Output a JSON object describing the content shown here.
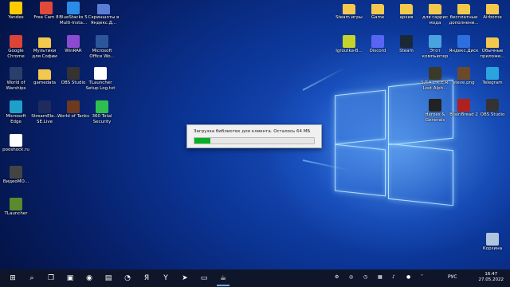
{
  "desktop": {
    "icons": [
      {
        "id": "yandex",
        "label": "Yandex",
        "icon": "yandex-icon",
        "color": "#ffcc00"
      },
      {
        "id": "freecam",
        "label": "Free Cam 8",
        "icon": "camera-icon",
        "color": "#e14a3b"
      },
      {
        "id": "bluestacks",
        "label": "BlueStacks 5 Multi-Insta...",
        "icon": "bluestacks-icon",
        "color": "#2b8be6"
      },
      {
        "id": "screenshots",
        "label": "Скриншоты в Яндекс.Д...",
        "icon": "folder-icon",
        "color": "#5a7dd6"
      },
      {
        "id": "chrome",
        "label": "Google Chrome",
        "icon": "chrome-icon",
        "color": "#db4437"
      },
      {
        "id": "cartoons",
        "label": "Мультики для Софии",
        "icon": "folder-icon",
        "color": "#f2c94c"
      },
      {
        "id": "winrar",
        "label": "WinRAR",
        "icon": "winrar-icon",
        "color": "#8a4bd1"
      },
      {
        "id": "msoffice",
        "label": "Microsoft Office Wo...",
        "icon": "word-icon",
        "color": "#2b579a"
      },
      {
        "id": "wows",
        "label": "World of Warships",
        "icon": "warships-icon",
        "color": "#2a3f6b"
      },
      {
        "id": "gamedata",
        "label": "gamedata",
        "icon": "folder-icon",
        "color": "#f2c94c"
      },
      {
        "id": "obs",
        "label": "OBS Studio",
        "icon": "obs-icon",
        "color": "#333333"
      },
      {
        "id": "tlauncherlog",
        "label": "TLauncher Setup Log.txt",
        "icon": "text-file-icon",
        "color": "#ffffff"
      },
      {
        "id": "edge",
        "label": "Microsoft Edge",
        "icon": "edge-icon",
        "color": "#1fa0c9"
      },
      {
        "id": "streamelements",
        "label": "StreamEle... SE.Live",
        "icon": "streamelements-icon",
        "color": "#1e2b5c"
      },
      {
        "id": "wot",
        "label": "World of Tanks",
        "icon": "tanks-icon",
        "color": "#6b3a1f"
      },
      {
        "id": "360",
        "label": "360 Total Security",
        "icon": "security-icon",
        "color": "#2fbf4f"
      },
      {
        "id": "pooshock",
        "label": "pooshock.ru",
        "icon": "document-icon",
        "color": "#ffffff"
      },
      {
        "id": "video",
        "label": "ВидеоМО...",
        "icon": "video-icon",
        "color": "#444444"
      },
      {
        "id": "tlauncher",
        "label": "TLauncher",
        "icon": "minecraft-icon",
        "color": "#5a8a2e"
      },
      {
        "id": "steamgames",
        "label": "Steam игры",
        "icon": "folder-icon",
        "color": "#f2c94c"
      },
      {
        "id": "game",
        "label": "Game",
        "icon": "folder-icon",
        "color": "#f2c94c"
      },
      {
        "id": "archive",
        "label": "архив",
        "icon": "folder-icon",
        "color": "#f2c94c"
      },
      {
        "id": "gorris",
        "label": "для гаррис мода",
        "icon": "folder-icon",
        "color": "#f2c94c"
      },
      {
        "id": "freeaddons",
        "label": "бесплатные дополнени...",
        "icon": "folder-icon",
        "color": "#f2c94c"
      },
      {
        "id": "airborne",
        "label": "Airborne",
        "icon": "folder-icon",
        "color": "#f2c94c"
      },
      {
        "id": "igroutka",
        "label": "Igroutka-B...",
        "icon": "game-icon",
        "color": "#c4d42a"
      },
      {
        "id": "discord",
        "label": "Discord",
        "icon": "discord-icon",
        "color": "#5865f2"
      },
      {
        "id": "steam",
        "label": "Steam",
        "icon": "steam-icon",
        "color": "#1b2838"
      },
      {
        "id": "thispc",
        "label": "Этот компьютер",
        "icon": "computer-icon",
        "color": "#4aa3df"
      },
      {
        "id": "yadisk",
        "label": "Яндекс.Диск",
        "icon": "yandex-disk-icon",
        "color": "#2e6fe0"
      },
      {
        "id": "ordinary",
        "label": "Обычные приложе...",
        "icon": "folder-icon",
        "color": "#f2c94c"
      },
      {
        "id": "stalker",
        "label": "S.T.A.L.K.E.R. Lost Alph...",
        "icon": "stalker-icon",
        "color": "#3a3a2a"
      },
      {
        "id": "stevepng",
        "label": "steve.png",
        "icon": "image-icon",
        "color": "#6b4a2b"
      },
      {
        "id": "telegram",
        "label": "Telegram",
        "icon": "telegram-icon",
        "color": "#2aa3df"
      },
      {
        "id": "heroes",
        "label": "Heroes & Generals",
        "icon": "heroes-icon",
        "color": "#222222"
      },
      {
        "id": "brainbread",
        "label": "BrainBread 2",
        "icon": "brainbread-icon",
        "color": "#b02020"
      },
      {
        "id": "obs2",
        "label": "OBS Studio",
        "icon": "obs-icon",
        "color": "#333333"
      },
      {
        "id": "recycle",
        "label": "Корзина",
        "icon": "recycle-bin-icon",
        "color": "#b0c4de"
      }
    ]
  },
  "dialog": {
    "message": "Загрузка библиотек для клиента. Осталось 64 МБ",
    "progress": 0.13,
    "progress_color": "#06b025"
  },
  "taskbar": {
    "apps": [
      "start-icon",
      "search-icon",
      "task-view-icon",
      "widgets-icon",
      "obs-icon",
      "taskbar-app-icon",
      "discord-icon",
      "yandex-icon",
      "yandex-browser-icon",
      "telegram-icon",
      "folder-icon",
      "java-icon"
    ],
    "tray_icons": [
      "gear-icon",
      "steam-icon",
      "clock-icon",
      "network-icon",
      "volume-icon",
      "mic-icon",
      "chevron-up-icon"
    ],
    "language": "РУС",
    "time": "16:47",
    "date": "27.05.2022"
  }
}
